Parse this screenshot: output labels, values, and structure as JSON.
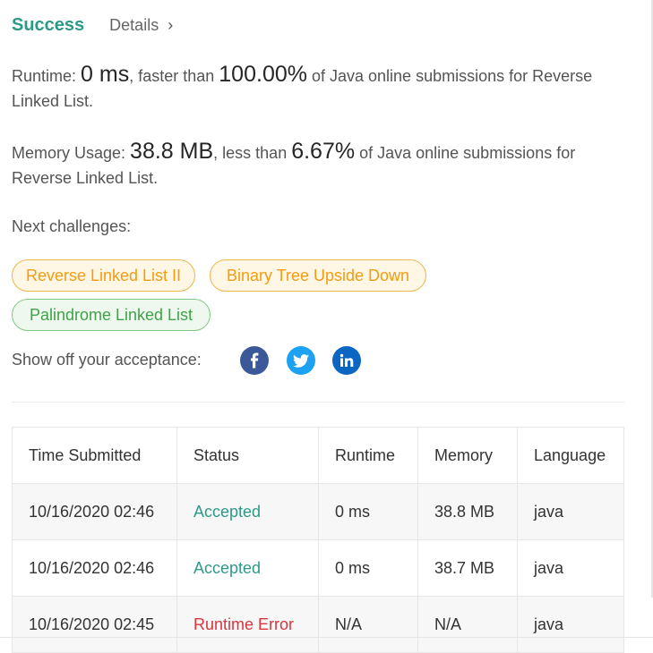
{
  "header": {
    "status": "Success",
    "details_label": "Details",
    "details_chevron": "›"
  },
  "runtime": {
    "prefix": "Runtime: ",
    "value": "0 ms",
    "middle": ", faster than ",
    "percent": "100.00%",
    "suffix": " of Java online submissions for Reverse Linked List."
  },
  "memory": {
    "prefix": "Memory Usage: ",
    "value": "38.8 MB",
    "middle": ", less than ",
    "percent": "6.67%",
    "suffix": " of Java online submissions for Reverse Linked List."
  },
  "next": {
    "label": "Next challenges:",
    "items": [
      {
        "label": "Reverse Linked List II",
        "difficulty": "medium"
      },
      {
        "label": "Binary Tree Upside Down",
        "difficulty": "medium"
      },
      {
        "label": "Palindrome Linked List",
        "difficulty": "easy"
      }
    ]
  },
  "share": {
    "label": "Show off your acceptance:",
    "icons": [
      "facebook-icon",
      "twitter-icon",
      "linkedin-icon"
    ]
  },
  "table": {
    "headers": [
      "Time Submitted",
      "Status",
      "Runtime",
      "Memory",
      "Language"
    ],
    "rows": [
      [
        "10/16/2020 02:46",
        "Accepted",
        "0 ms",
        "38.8 MB",
        "java"
      ],
      [
        "10/16/2020 02:46",
        "Accepted",
        "0 ms",
        "38.7 MB",
        "java"
      ],
      [
        "10/16/2020 02:45",
        "Runtime Error",
        "N/A",
        "N/A",
        "java"
      ]
    ]
  },
  "colors": {
    "success": "#2d9a88",
    "medium_chip": "#f39c12",
    "easy_chip": "#3fa24a",
    "error": "#d9363e"
  }
}
